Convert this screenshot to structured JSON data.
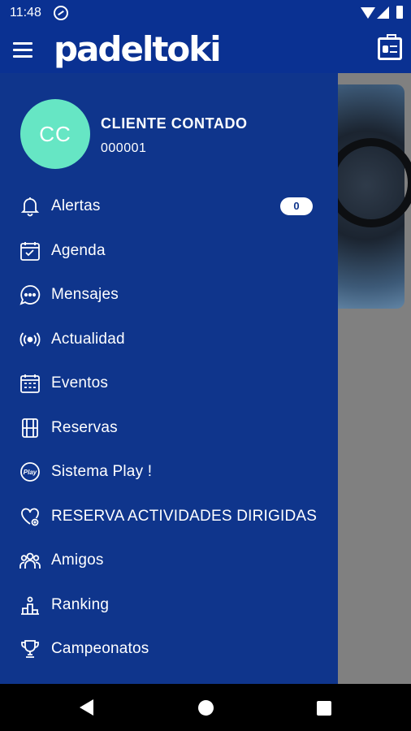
{
  "status": {
    "time": "11:48"
  },
  "app": {
    "logo_text": "padeltoki"
  },
  "user": {
    "initials": "CC",
    "name": "CLIENTE CONTADO",
    "code": "000001"
  },
  "alerts_badge": "0",
  "menu": [
    {
      "label": "Alertas",
      "icon": "bell-icon"
    },
    {
      "label": "Agenda",
      "icon": "calendar-check-icon"
    },
    {
      "label": "Mensajes",
      "icon": "chat-bubble-icon"
    },
    {
      "label": "Actualidad",
      "icon": "broadcast-icon"
    },
    {
      "label": "Eventos",
      "icon": "calendar-grid-icon"
    },
    {
      "label": "Reservas",
      "icon": "court-icon"
    },
    {
      "label": "Sistema Play !",
      "icon": "play-badge-icon"
    },
    {
      "label": "RESERVA ACTIVIDADES DIRIGIDAS",
      "icon": "heart-icon"
    },
    {
      "label": "Amigos",
      "icon": "group-icon"
    },
    {
      "label": "Ranking",
      "icon": "podium-icon"
    },
    {
      "label": "Campeonatos",
      "icon": "trophy-icon"
    }
  ],
  "colors": {
    "primary": "#0a3192",
    "drawer": "#0f358c",
    "avatar": "#66e6c4"
  }
}
